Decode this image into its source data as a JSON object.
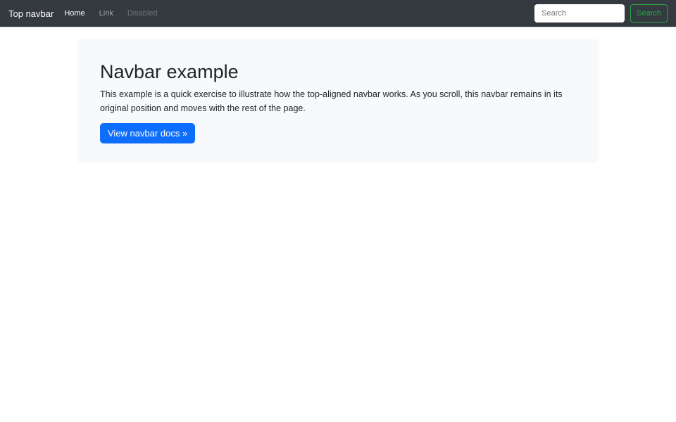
{
  "navbar": {
    "brand": "Top navbar",
    "links": [
      {
        "label": "Home",
        "state": "active"
      },
      {
        "label": "Link",
        "state": "default"
      },
      {
        "label": "Disabled",
        "state": "disabled"
      }
    ],
    "search": {
      "placeholder": "Search",
      "button_label": "Search"
    },
    "colors": {
      "background": "#343a40",
      "brand_text": "#ffffff",
      "active_link": "#ffffff",
      "link": "rgba(255,255,255,0.55)",
      "disabled_link": "rgba(255,255,255,0.28)",
      "search_button_green": "#28a745",
      "search_input_background": "#ffffff"
    }
  },
  "main": {
    "hero": {
      "title": "Navbar example",
      "description": "This example is a quick exercise to illustrate how the top-aligned navbar works. As you scroll, this navbar remains in its original position and moves with the rest of the page.",
      "cta_label": "View navbar docs »",
      "colors": {
        "background": "#f8f9fa",
        "title_text": "#212529",
        "cta_background": "#0d6efd",
        "cta_text": "#ffffff"
      }
    }
  }
}
